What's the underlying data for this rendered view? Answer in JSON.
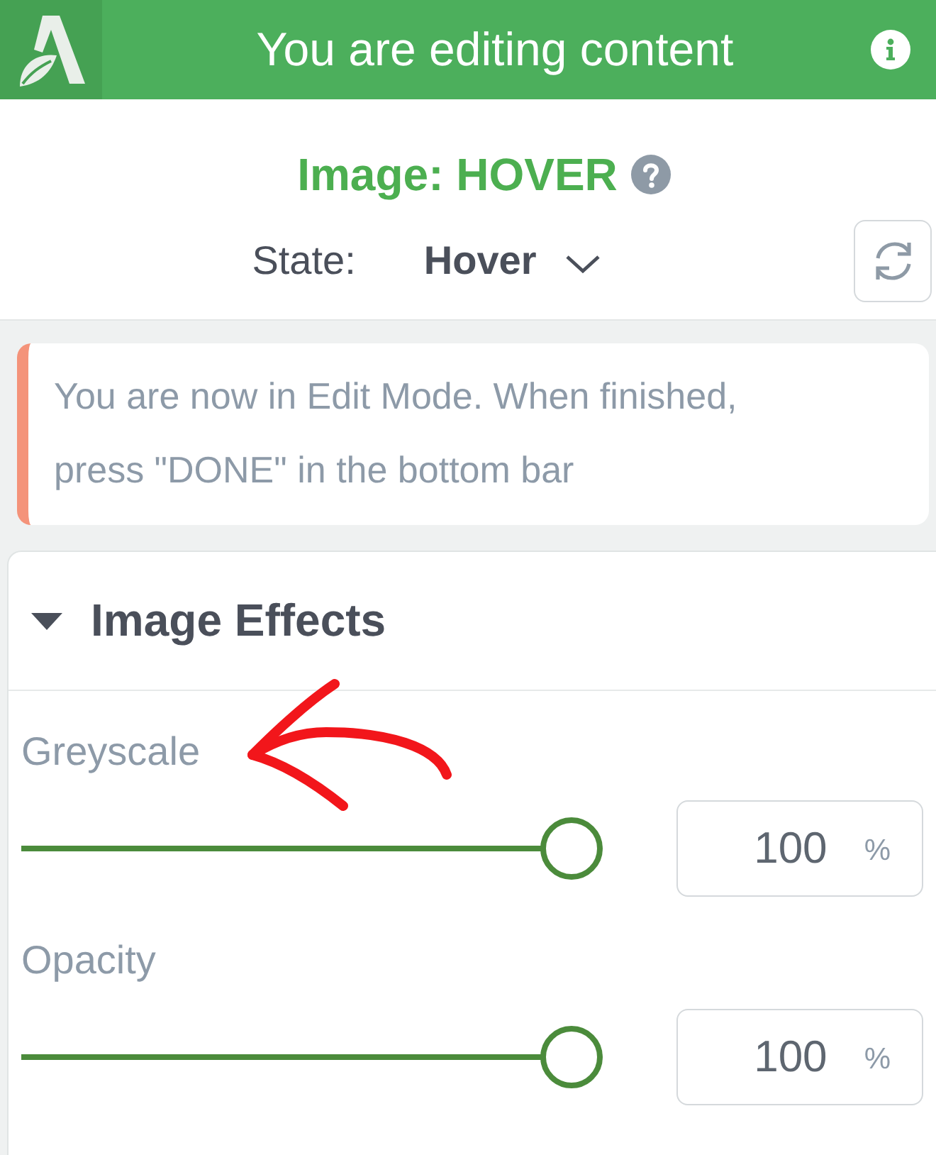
{
  "header": {
    "title": "You are editing content"
  },
  "element": {
    "title": "Image: HOVER",
    "state_label": "State:",
    "state_value": "Hover"
  },
  "notice": {
    "text": "You are now in Edit Mode. When finished, press \"DONE\" in the bottom bar"
  },
  "panel": {
    "title": "Image Effects",
    "expanded": true,
    "controls": [
      {
        "label": "Greyscale",
        "level": 1,
        "value": "100",
        "unit": "%"
      },
      {
        "label": "Opacity",
        "level": 1,
        "value": "100",
        "unit": "%"
      }
    ]
  }
}
